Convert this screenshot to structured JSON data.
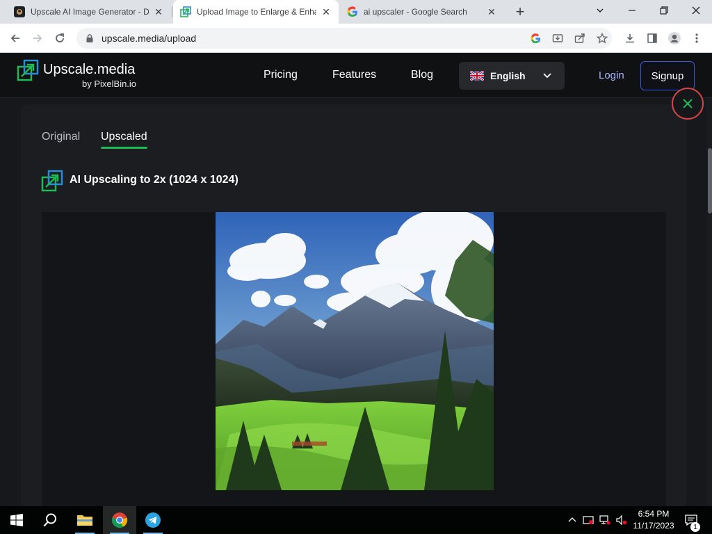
{
  "browser": {
    "tabs": [
      {
        "title": "Upscale AI Image Generator - D",
        "icon": "upscale-app-favicon",
        "active": false
      },
      {
        "title": "Upload Image to Enlarge & Enha",
        "icon": "upscale-media-favicon",
        "active": true
      },
      {
        "title": "ai upscaler - Google Search",
        "icon": "google-favicon",
        "active": false
      }
    ],
    "new_tab_label": "+",
    "url": "upscale.media/upload"
  },
  "site": {
    "brand": "Upscale.media",
    "brand_sub": "by PixelBin.io",
    "nav": [
      "Pricing",
      "Features",
      "Blog"
    ],
    "language": "English",
    "login": "Login",
    "signup": "Signup",
    "accent_color": "#1fb955"
  },
  "panel": {
    "tabs": [
      {
        "label": "Original",
        "active": false
      },
      {
        "label": "Upscaled",
        "active": true
      }
    ],
    "title": "AI Upscaling to 2x (1024 x 1024)",
    "image_subject": "mountain valley landscape"
  },
  "taskbar": {
    "apps": [
      "windows-start",
      "search",
      "file-explorer",
      "chrome",
      "telegram"
    ],
    "time": "6:54 PM",
    "date": "11/17/2023",
    "notification_count": "1"
  }
}
